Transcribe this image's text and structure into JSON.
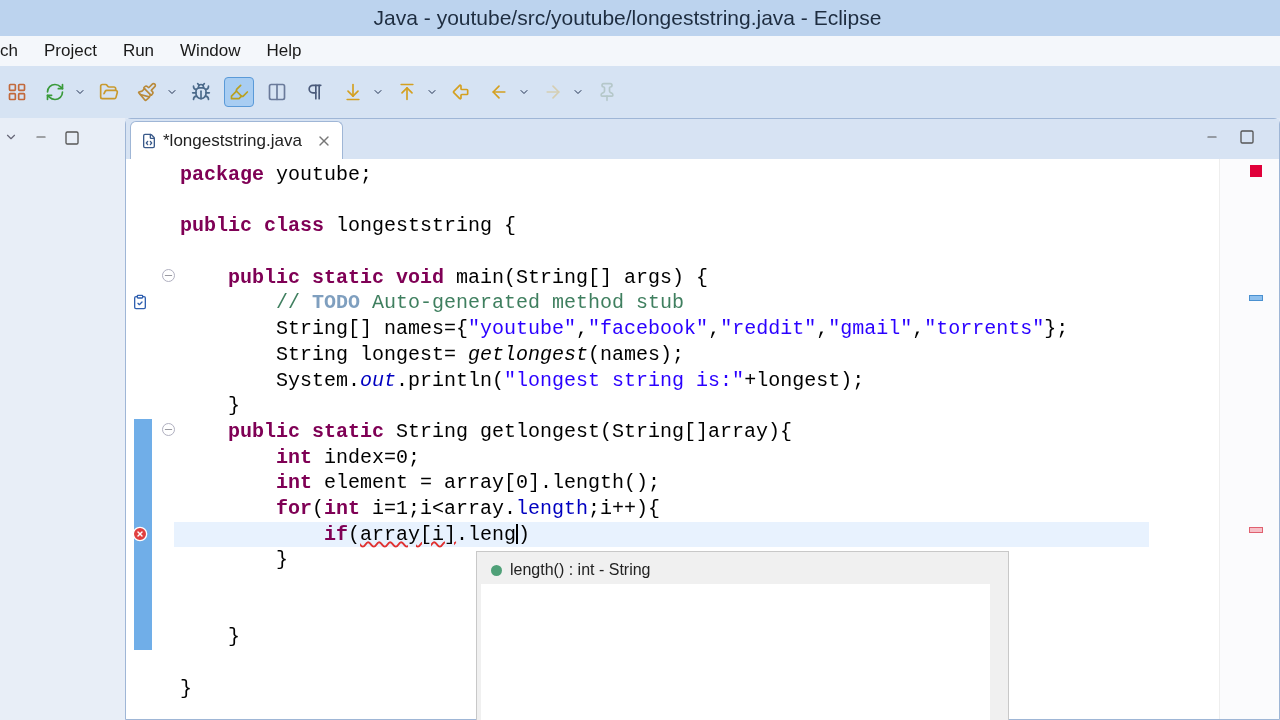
{
  "window": {
    "title": "Java - youtube/src/youtube/longeststring.java - Eclipse"
  },
  "menu": [
    "ch",
    "Project",
    "Run",
    "Window",
    "Help"
  ],
  "toolbar": [
    {
      "selected": false,
      "disabled": false,
      "dropdown": false
    },
    {
      "selected": false,
      "disabled": false,
      "dropdown": true
    },
    {
      "selected": false,
      "disabled": false,
      "dropdown": false
    },
    {
      "selected": false,
      "disabled": false,
      "dropdown": true
    },
    {
      "selected": false,
      "disabled": false,
      "dropdown": false
    },
    {
      "selected": true,
      "disabled": false,
      "dropdown": false
    },
    {
      "selected": false,
      "disabled": false,
      "dropdown": false
    },
    {
      "selected": false,
      "disabled": false,
      "dropdown": false
    },
    {
      "selected": false,
      "disabled": false,
      "dropdown": true
    },
    {
      "selected": false,
      "disabled": false,
      "dropdown": true
    },
    {
      "selected": false,
      "disabled": false,
      "dropdown": false
    },
    {
      "selected": false,
      "disabled": false,
      "dropdown": true
    },
    {
      "selected": false,
      "disabled": true,
      "dropdown": true
    },
    {
      "selected": false,
      "disabled": true,
      "dropdown": false
    }
  ],
  "editor_tab": {
    "label": "*longeststring.java",
    "selected": true
  },
  "code_lines": [
    {
      "kind": "plain",
      "changed": false,
      "current": false,
      "tokens": [
        {
          "kind": "keyword",
          "text": "package"
        },
        {
          "kind": "plain",
          "text": " youtube;"
        }
      ]
    },
    {
      "kind": "plain",
      "changed": false,
      "current": false
    },
    {
      "kind": "plain",
      "changed": false,
      "current": false,
      "tokens": [
        {
          "kind": "keyword",
          "text": "public class"
        },
        {
          "kind": "plain",
          "text": " longeststring {"
        }
      ]
    },
    {
      "kind": "plain",
      "changed": false,
      "current": false
    },
    {
      "kind": "fold",
      "changed": false,
      "current": false,
      "tokens": [
        {
          "kind": "keyword",
          "text": "    public static void"
        },
        {
          "kind": "plain",
          "text": " main(String[] args) {"
        }
      ]
    },
    {
      "kind": "task",
      "changed": false,
      "current": false,
      "tokens": [
        {
          "kind": "comment",
          "text": "        //"
        },
        {
          "kind": "todo",
          "text": " TODO"
        },
        {
          "kind": "comment",
          "text": " Auto-generated method stub"
        }
      ]
    },
    {
      "kind": "plain",
      "changed": false,
      "current": false,
      "tokens": [
        {
          "kind": "plain",
          "text": "        String[] names={"
        },
        {
          "kind": "string",
          "text": "\"youtube\""
        },
        {
          "kind": "plain",
          "text": ","
        },
        {
          "kind": "string",
          "text": "\"facebook\""
        },
        {
          "kind": "plain",
          "text": ","
        },
        {
          "kind": "string",
          "text": "\"reddit\""
        },
        {
          "kind": "plain",
          "text": ","
        },
        {
          "kind": "string",
          "text": "\"gmail\""
        },
        {
          "kind": "plain",
          "text": ","
        },
        {
          "kind": "string",
          "text": "\"torrents\""
        },
        {
          "kind": "plain",
          "text": "};"
        }
      ]
    },
    {
      "kind": "plain",
      "changed": false,
      "current": false,
      "tokens": [
        {
          "kind": "plain",
          "text": "        String longest= "
        },
        {
          "kind": "static_call",
          "text": "getlongest"
        },
        {
          "kind": "plain",
          "text": "(names);"
        }
      ]
    },
    {
      "kind": "plain",
      "changed": false,
      "current": false,
      "tokens": [
        {
          "kind": "plain",
          "text": "        System."
        },
        {
          "kind": "static_field",
          "text": "out"
        },
        {
          "kind": "plain",
          "text": ".println("
        },
        {
          "kind": "string",
          "text": "\"longest string is:\""
        },
        {
          "kind": "plain",
          "text": "+longest);"
        }
      ]
    },
    {
      "kind": "plain",
      "changed": false,
      "current": false,
      "tokens": [
        {
          "kind": "plain",
          "text": "    }"
        }
      ]
    },
    {
      "kind": "fold",
      "changed": true,
      "current": false,
      "tokens": [
        {
          "kind": "keyword",
          "text": "    public static"
        },
        {
          "kind": "plain",
          "text": " String getlongest(String[]array){"
        }
      ]
    },
    {
      "kind": "plain",
      "changed": true,
      "current": false,
      "tokens": [
        {
          "kind": "keyword",
          "text": "        int"
        },
        {
          "kind": "plain",
          "text": " index=0;"
        }
      ]
    },
    {
      "kind": "plain",
      "changed": true,
      "current": false,
      "tokens": [
        {
          "kind": "keyword",
          "text": "        int"
        },
        {
          "kind": "plain",
          "text": " element = array[0].length();"
        }
      ]
    },
    {
      "kind": "plain",
      "changed": true,
      "current": false,
      "tokens": [
        {
          "kind": "keyword",
          "text": "        for"
        },
        {
          "kind": "plain",
          "text": "("
        },
        {
          "kind": "keyword",
          "text": "int"
        },
        {
          "kind": "plain",
          "text": " i=1;i<array."
        },
        {
          "kind": "field",
          "text": "length"
        },
        {
          "kind": "plain",
          "text": ";i++){"
        }
      ]
    },
    {
      "kind": "error",
      "changed": true,
      "current": true,
      "tokens": [
        {
          "kind": "keyword",
          "text": "            if"
        },
        {
          "kind": "plain",
          "text": "("
        },
        {
          "kind": "error",
          "text": "array[i]"
        },
        {
          "kind": "caret",
          "text": ".leng"
        },
        {
          "kind": "plain",
          "text": ")"
        }
      ]
    },
    {
      "kind": "plain",
      "changed": true,
      "current": false,
      "tokens": [
        {
          "kind": "plain",
          "text": "        }"
        }
      ]
    },
    {
      "kind": "plain",
      "changed": true,
      "current": false
    },
    {
      "kind": "plain",
      "changed": true,
      "current": false
    },
    {
      "kind": "plain",
      "changed": true,
      "current": false,
      "tokens": [
        {
          "kind": "plain",
          "text": "    }"
        }
      ]
    },
    {
      "kind": "plain",
      "changed": false,
      "current": false
    },
    {
      "kind": "plain",
      "changed": false,
      "current": false,
      "tokens": [
        {
          "kind": "plain",
          "text": "}"
        }
      ]
    }
  ],
  "completion": {
    "items": [
      {
        "label": "length() : int - String",
        "selected": true
      }
    ]
  }
}
